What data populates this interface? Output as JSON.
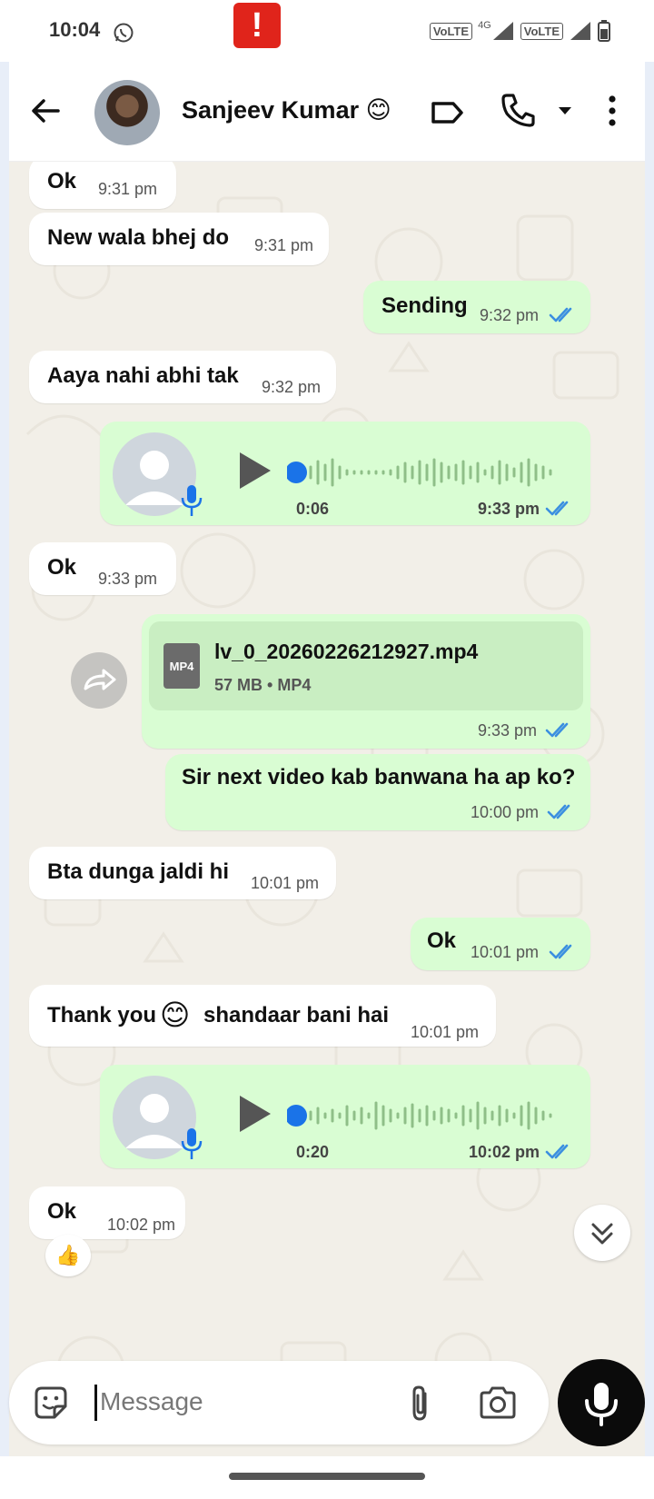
{
  "status_bar": {
    "time": "10:04",
    "alert": "!",
    "volte1": "VoLTE",
    "volte2": "VoLTE",
    "net": "4G"
  },
  "header": {
    "contact_name": "Sanjeev Kumar 😊",
    "icons": [
      "back-arrow-icon",
      "label-icon",
      "phone-icon",
      "chevron-down-icon",
      "more-vert-icon"
    ]
  },
  "messages": [
    {
      "dir": "in",
      "text": "Ok",
      "time": "9:31 pm"
    },
    {
      "dir": "in",
      "text": "New wala bhej do",
      "time": "9:31 pm"
    },
    {
      "dir": "out",
      "text": "Sending",
      "time": "9:32 pm"
    },
    {
      "dir": "in",
      "text": "Aaya nahi abhi tak",
      "time": "9:32 pm"
    },
    {
      "dir": "out",
      "type": "voice",
      "duration": "0:06",
      "time": "9:33 pm"
    },
    {
      "dir": "in",
      "text": "Ok",
      "time": "9:33 pm"
    },
    {
      "dir": "out",
      "type": "file",
      "file_name": "lv_0_20260226212927.mp4",
      "file_meta": "57 MB • MP4",
      "file_type": "MP4",
      "time": "9:33 pm"
    },
    {
      "dir": "out",
      "text": "Sir next video kab banwana ha ap ko?",
      "time": "10:00 pm"
    },
    {
      "dir": "in",
      "text": "Bta dunga jaldi hi",
      "time": "10:01 pm"
    },
    {
      "dir": "out",
      "text": "Ok",
      "time": "10:01 pm"
    },
    {
      "dir": "in",
      "text_a": "Thank you",
      "emoji": "😊",
      "text_b": "shandaar bani hai",
      "time": "10:01 pm"
    },
    {
      "dir": "out",
      "type": "voice",
      "duration": "0:20",
      "time": "10:02 pm"
    },
    {
      "dir": "in",
      "text": "Ok",
      "time": "10:02 pm",
      "reaction": "👍"
    }
  ],
  "composer": {
    "placeholder": "Message"
  },
  "colors": {
    "incoming": "#ffffff",
    "outgoing": "#d9fdd3",
    "read_ticks": "#3b8fe0",
    "voice_dot": "#1a73e8",
    "wallpaper": "#f2efe8",
    "alert": "#e0241b"
  }
}
